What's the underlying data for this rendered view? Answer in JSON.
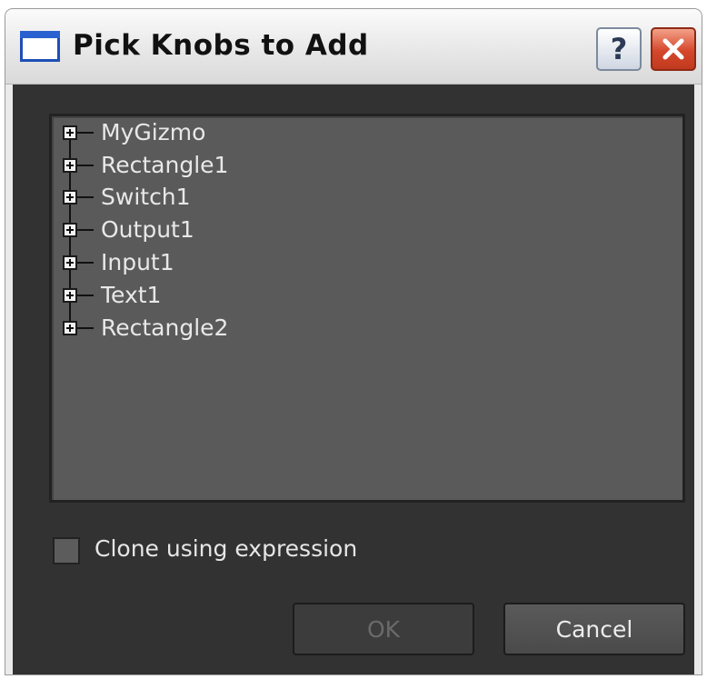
{
  "window": {
    "title": "Pick Knobs to Add",
    "help_button": "?"
  },
  "tree": {
    "items": [
      {
        "label": "MyGizmo"
      },
      {
        "label": "Rectangle1"
      },
      {
        "label": "Switch1"
      },
      {
        "label": "Output1"
      },
      {
        "label": "Input1"
      },
      {
        "label": "Text1"
      },
      {
        "label": "Rectangle2"
      }
    ]
  },
  "options": {
    "clone_label": "Clone using expression",
    "clone_checked": false
  },
  "buttons": {
    "ok": "OK",
    "cancel": "Cancel"
  },
  "icons": {
    "window": "window-icon",
    "help": "help-icon",
    "close": "close-icon",
    "expand": "plus-expander-icon"
  },
  "colors": {
    "dialog_bg": "#323232",
    "list_bg": "#5a5a5a",
    "close_red": "#d5472b"
  }
}
